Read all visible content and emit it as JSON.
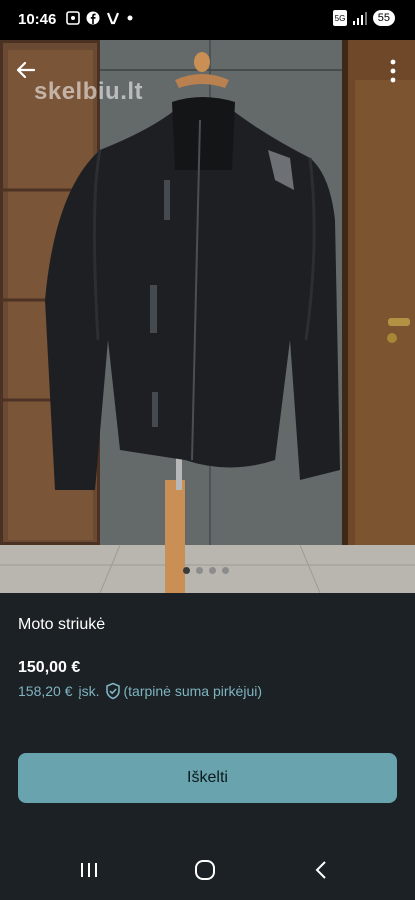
{
  "status_bar": {
    "time": "10:46",
    "network": "5G",
    "battery": "55",
    "icons": [
      "screenshot-icon",
      "facebook-icon",
      "v-app-icon",
      "dot-icon"
    ]
  },
  "photo": {
    "watermark": "skelbiu.lt",
    "carousel_total": 4,
    "carousel_active": 1
  },
  "listing": {
    "title": "Moto striukė",
    "price": "150,00 €",
    "buyer_price": "158,20 €",
    "buyer_incl": "įsk.",
    "buyer_note": "(tarpinė suma pirkėjui)"
  },
  "actions": {
    "promote_label": "Iškelti"
  },
  "colors": {
    "background": "#1b2124",
    "accent": "#68a3ae",
    "link": "#7fb4c1"
  }
}
